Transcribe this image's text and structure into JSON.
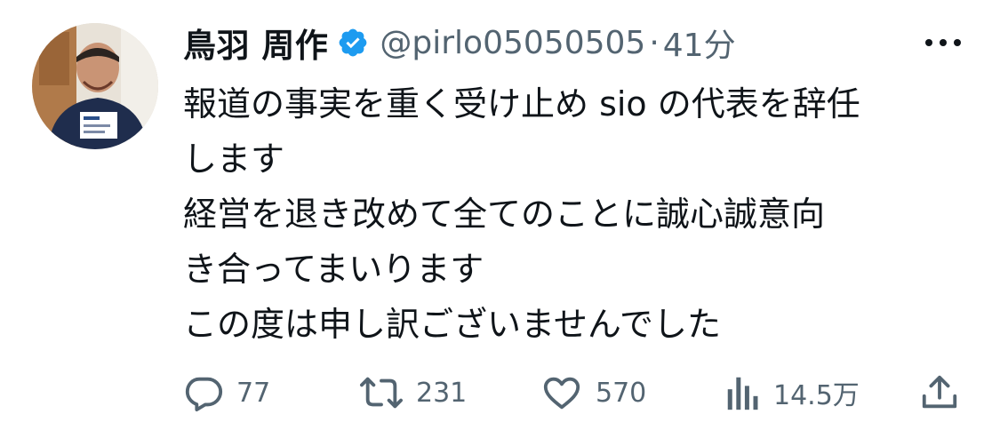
{
  "tweet": {
    "author": {
      "display_name": "鳥羽 周作",
      "handle": "@pirlo05050505",
      "verified": true
    },
    "separator": "·",
    "timestamp": "41分",
    "text_lines": [
      "報道の事実を重く受け止め sio の代表を辞任",
      "します",
      "経営を退き改めて全てのことに誠心誠意向",
      "き合ってまいります",
      "この度は申し訳ございませんでした"
    ],
    "metrics": {
      "replies": "77",
      "retweets": "231",
      "likes": "570",
      "views": "14.5万"
    }
  },
  "icons": {
    "verified": "verified-badge-icon",
    "more": "more-horizontal-icon",
    "reply": "reply-icon",
    "retweet": "retweet-icon",
    "like": "heart-icon",
    "views": "views-bar-chart-icon",
    "share": "share-icon"
  },
  "colors": {
    "text_primary": "#0f1419",
    "text_secondary": "#536471",
    "verified_blue": "#1d9bf0",
    "background": "#ffffff"
  }
}
